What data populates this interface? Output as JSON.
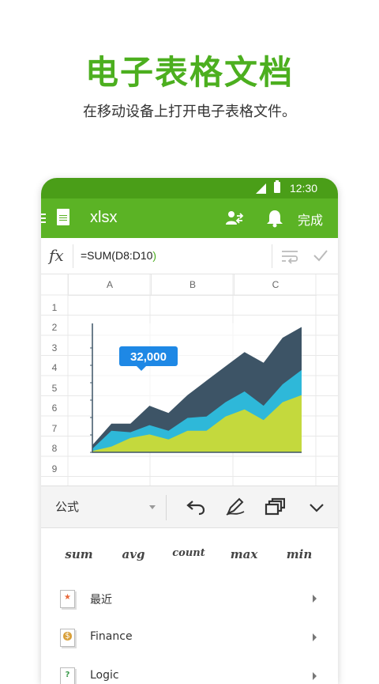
{
  "hero": {
    "title": "电子表格文档",
    "subtitle": "在移动设备上打开电子表格文件。"
  },
  "status_bar": {
    "time": "12:30"
  },
  "app_bar": {
    "file_name": "xlsx",
    "done_label": "完成",
    "icons": [
      "menu-icon",
      "document-icon",
      "share-user-icon",
      "bell-icon"
    ]
  },
  "formula_bar": {
    "fx_label": "fx",
    "formula_prefix": "=SUM(",
    "formula_range": "D8:D10",
    "formula_suffix": ")",
    "icons": [
      "wrap-text-icon",
      "check-icon"
    ]
  },
  "sheet": {
    "columns": [
      "A",
      "B",
      "C"
    ],
    "rows": [
      "1",
      "2",
      "3",
      "4",
      "5",
      "6",
      "7",
      "8",
      "9"
    ]
  },
  "chart_data": {
    "type": "area",
    "x": [
      1,
      2,
      3,
      4,
      5,
      6,
      7,
      8,
      9,
      10,
      11,
      12
    ],
    "series": [
      {
        "values": [
          10,
          40,
          40,
          65,
          55,
          80,
          100,
          120,
          140,
          125,
          160,
          175
        ],
        "color": "#3d5466"
      },
      {
        "values": [
          5,
          30,
          28,
          38,
          30,
          48,
          50,
          70,
          85,
          65,
          95,
          115
        ],
        "color": "#2eb8d9"
      },
      {
        "values": [
          2,
          8,
          20,
          25,
          18,
          30,
          30,
          50,
          60,
          45,
          70,
          80
        ],
        "color": "#c4d93d"
      }
    ],
    "annotations": [
      "32,000"
    ],
    "ylim": [
      0,
      180
    ],
    "grid": false
  },
  "toolbar": {
    "formula_label": "公式",
    "icons": [
      "undo-icon",
      "pen-icon",
      "copy-icon",
      "chevron-down-icon"
    ]
  },
  "functions": [
    "sum",
    "avg",
    "count",
    "max",
    "min"
  ],
  "categories": [
    {
      "label": "最近",
      "icon": "star-icon",
      "color": "#e8683a"
    },
    {
      "label": "Finance",
      "icon": "money-bag-icon",
      "color": "#c98a2a"
    },
    {
      "label": "Logic",
      "icon": "question-icon",
      "color": "#3a9a4a"
    }
  ]
}
